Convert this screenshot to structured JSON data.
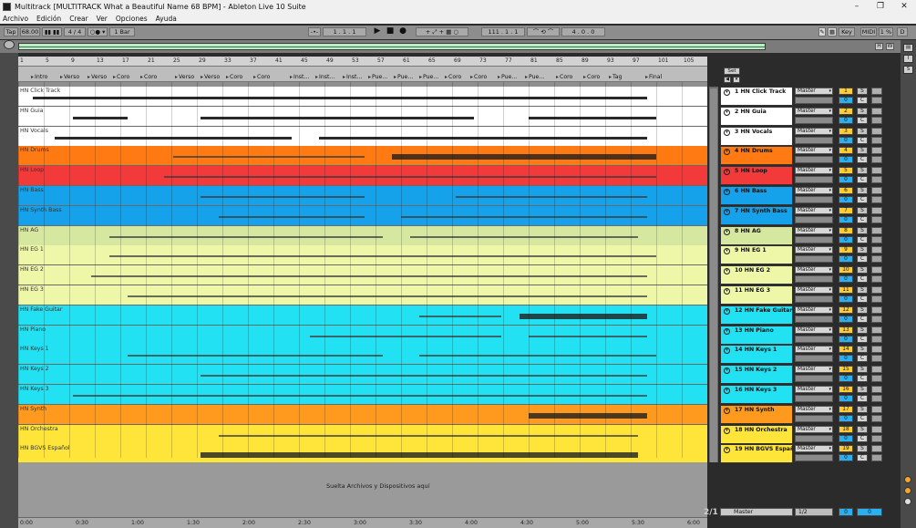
{
  "window": {
    "title": "Multitrack  [MULTITRACK What a Beautiful Name 68 BPM] - Ableton Live 10 Suite",
    "minimize": "–",
    "maximize": "❐",
    "close": "✕"
  },
  "menu": [
    "Archivo",
    "Edición",
    "Crear",
    "Ver",
    "Opciones",
    "Ayuda"
  ],
  "control": {
    "tap": "Tap",
    "tempo": "68.00",
    "meter": "4 / 4",
    "metronome": "1 Bar",
    "position": "1 .   1 .   1",
    "loop_start": "111 .   1 .   1",
    "loop_length": "4 .   0 .   0",
    "key": "Key",
    "midi": "MIDI",
    "cpu": "1 %",
    "d": "D"
  },
  "overview": {
    "h": "H",
    "w": "W"
  },
  "ruler_bars": [
    "1",
    "5",
    "9",
    "13",
    "17",
    "21",
    "25",
    "29",
    "33",
    "37",
    "41",
    "45",
    "49",
    "53",
    "57",
    "61",
    "65",
    "69",
    "73",
    "77",
    "81",
    "85",
    "89",
    "93",
    "97",
    "101",
    "105"
  ],
  "locators": [
    "Intro",
    "Verso",
    "Verso",
    "Coro",
    "Coro",
    "Verso",
    "Verso",
    "Coro",
    "Coro",
    "Inst...",
    "Inst...",
    "Inst...",
    "Pue...",
    "Pue...",
    "Pue...",
    "Coro",
    "Coro",
    "Pue...",
    "Pue...",
    "Coro",
    "Coro",
    "Tag",
    "Final"
  ],
  "set_label": "Set",
  "tracks": [
    {
      "clip": "HN Click Track",
      "name": "1 HN Click Track",
      "num": "1",
      "color": "#ffffff",
      "io": "Master"
    },
    {
      "clip": "HN Guia",
      "name": "2 HN Guia",
      "num": "2",
      "color": "#ffffff",
      "io": "Master"
    },
    {
      "clip": "HN Vocals",
      "name": "3 HN Vocals",
      "num": "3",
      "color": "#ffffff",
      "io": "Master"
    },
    {
      "clip": "HN Drums",
      "name": "4 HN Drums",
      "num": "4",
      "color": "#ff7a12",
      "io": "Master"
    },
    {
      "clip": "HN Loop",
      "name": "5 HN Loop",
      "num": "5",
      "color": "#f23a3a",
      "io": "Master"
    },
    {
      "clip": "HN Bass",
      "name": "6 HN Bass",
      "num": "6",
      "color": "#16a2ea",
      "io": "Master"
    },
    {
      "clip": "HN Synth Bass",
      "name": "7 HN Synth Bass",
      "num": "7",
      "color": "#16a2ea",
      "io": "Master"
    },
    {
      "clip": "HN AG",
      "name": "8 HN AG",
      "num": "8",
      "color": "#d6e8a0",
      "io": "Master"
    },
    {
      "clip": "HN EG 1",
      "name": "9 HN EG 1",
      "num": "9",
      "color": "#eef7a8",
      "io": "Master"
    },
    {
      "clip": "HN EG 2",
      "name": "10 HN EG 2",
      "num": "10",
      "color": "#eef7a8",
      "io": "Master"
    },
    {
      "clip": "HN EG 3",
      "name": "11 HN EG 3",
      "num": "11",
      "color": "#eef7a8",
      "io": "Master"
    },
    {
      "clip": "HN Fake Guitar",
      "name": "12 HN Fake Guitar",
      "num": "12",
      "color": "#21e1f2",
      "io": "Master"
    },
    {
      "clip": "HN Piano",
      "name": "13 HN Piano",
      "num": "13",
      "color": "#21e1f2",
      "io": "Master"
    },
    {
      "clip": "HN Keys 1",
      "name": "14 HN Keys 1",
      "num": "14",
      "color": "#21e1f2",
      "io": "Master"
    },
    {
      "clip": "HN Keys 2",
      "name": "15 HN Keys 2",
      "num": "15",
      "color": "#21e1f2",
      "io": "Master"
    },
    {
      "clip": "HN Keys 3",
      "name": "16 HN Keys 3",
      "num": "16",
      "color": "#21e1f2",
      "io": "Master"
    },
    {
      "clip": "HN Synth",
      "name": "17 HN Synth",
      "num": "17",
      "color": "#ff9a1f",
      "io": "Master"
    },
    {
      "clip": "HN Orchestra",
      "name": "18 HN Orchestra",
      "num": "18",
      "color": "#ffe53a",
      "io": "Master"
    },
    {
      "clip": "HN BGVS Español",
      "name": "19 HN BGVS Español",
      "num": "19",
      "color": "#ffe53a",
      "io": "Master"
    }
  ],
  "track_zero": "0",
  "solo_label": "S",
  "c_label": "C",
  "drop_text": "Suelta Archivos y Dispositivos aquí",
  "time_labels": [
    "0:00",
    "0:30",
    "1:00",
    "1:30",
    "2:00",
    "2:30",
    "3:00",
    "3:30",
    "4:00",
    "4:30",
    "5:00",
    "5:30",
    "6:00"
  ],
  "ratio": "2/1",
  "master": {
    "name": "Master",
    "io": "1/2",
    "vol": "0",
    "vol2": "0"
  }
}
